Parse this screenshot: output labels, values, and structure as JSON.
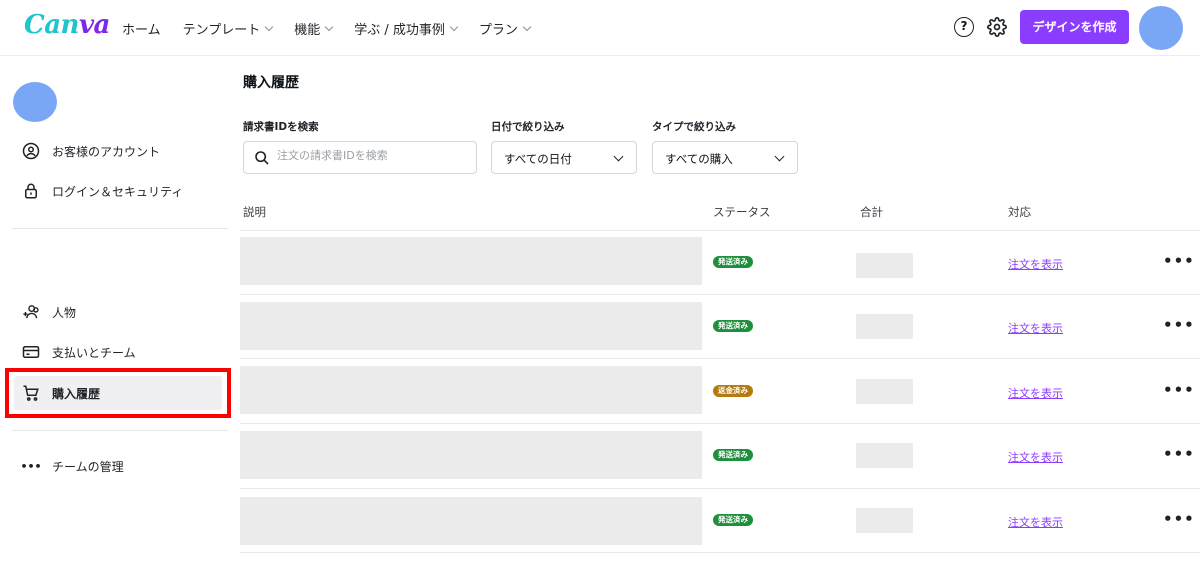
{
  "header": {
    "logo": "Canva",
    "nav": [
      {
        "label": "ホーム",
        "dropdown": false
      },
      {
        "label": "テンプレート",
        "dropdown": true
      },
      {
        "label": "機能",
        "dropdown": true
      },
      {
        "label": "学ぶ / 成功事例",
        "dropdown": true
      },
      {
        "label": "プラン",
        "dropdown": true
      }
    ],
    "help_icon": "?",
    "create_button": "デザインを作成"
  },
  "sidebar": {
    "items_top": [
      {
        "label": "お客様のアカウント",
        "icon": "user-circle-icon"
      },
      {
        "label": "ログイン＆セキュリティ",
        "icon": "lock-icon"
      }
    ],
    "items_mid": [
      {
        "label": "人物",
        "icon": "people-add-icon"
      },
      {
        "label": "支払いとチーム",
        "icon": "credit-card-icon"
      },
      {
        "label": "購入履歴",
        "icon": "cart-icon",
        "active": true
      }
    ],
    "items_bottom": [
      {
        "label": "チームの管理",
        "icon": "more-dots-icon"
      }
    ]
  },
  "main": {
    "title": "購入履歴",
    "filters": {
      "search_label": "請求書IDを検索",
      "search_placeholder": "注文の請求書IDを検索",
      "date_label": "日付で絞り込み",
      "date_value": "すべての日付",
      "type_label": "タイプで絞り込み",
      "type_value": "すべての購入"
    },
    "columns": [
      "説明",
      "ステータス",
      "合計",
      "対応"
    ],
    "rows": [
      {
        "status": "発送済み",
        "status_color": "#1f8e3d",
        "action": "注文を表示"
      },
      {
        "status": "発送済み",
        "status_color": "#1f8e3d",
        "action": "注文を表示"
      },
      {
        "status": "返金済み",
        "status_color": "#b5790f",
        "action": "注文を表示"
      },
      {
        "status": "発送済み",
        "status_color": "#1f8e3d",
        "action": "注文を表示"
      },
      {
        "status": "発送済み",
        "status_color": "#1f8e3d",
        "action": "注文を表示"
      }
    ],
    "more_label": "•••"
  }
}
